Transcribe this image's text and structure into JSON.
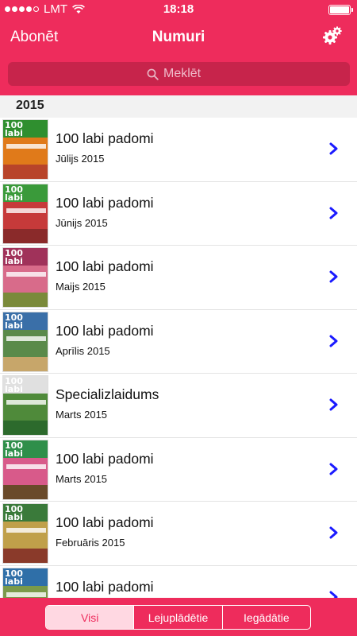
{
  "status": {
    "carrier": "LMT",
    "time": "18:18"
  },
  "nav": {
    "left_label": "Abonēt",
    "title": "Numuri",
    "gear_icon": "gear-icon"
  },
  "search": {
    "placeholder": "Meklēt"
  },
  "section": {
    "year": "2015"
  },
  "issues": [
    {
      "title": "100 labi padomi",
      "date": "Jūlijs 2015",
      "cover": [
        "#2f8f2f",
        "#e07a1a",
        "#b8442a"
      ]
    },
    {
      "title": "100 labi padomi",
      "date": "Jūnijs 2015",
      "cover": [
        "#3a9a3a",
        "#c63a3a",
        "#8a2a2a"
      ]
    },
    {
      "title": "100 labi padomi",
      "date": "Maijs 2015",
      "cover": [
        "#a0325a",
        "#d86b8a",
        "#7a8a3a"
      ]
    },
    {
      "title": "100 labi padomi",
      "date": "Aprīlis 2015",
      "cover": [
        "#3a6fa8",
        "#5a8a4a",
        "#c7a66a"
      ]
    },
    {
      "title": "Specializlaidums",
      "date": "Marts 2015",
      "cover": [
        "#e0e0e0",
        "#4f8a3a",
        "#2c6a2c"
      ]
    },
    {
      "title": "100 labi padomi",
      "date": "Marts 2015",
      "cover": [
        "#2f8f4a",
        "#d85a8a",
        "#6a4a2a"
      ]
    },
    {
      "title": "100 labi padomi",
      "date": "Februāris 2015",
      "cover": [
        "#3a7a3a",
        "#c0a04a",
        "#8a3a2a"
      ]
    },
    {
      "title": "100 labi padomi",
      "date": "",
      "cover": [
        "#2f6fa8",
        "#7a9a4a",
        "#c43a3a"
      ]
    }
  ],
  "tabs": [
    {
      "label": "Visi",
      "active": true
    },
    {
      "label": "Lejuplādētie",
      "active": false
    },
    {
      "label": "Iegādātie",
      "active": false
    }
  ],
  "colors": {
    "accent": "#ee2c5c",
    "chevron": "#1a1aff"
  }
}
